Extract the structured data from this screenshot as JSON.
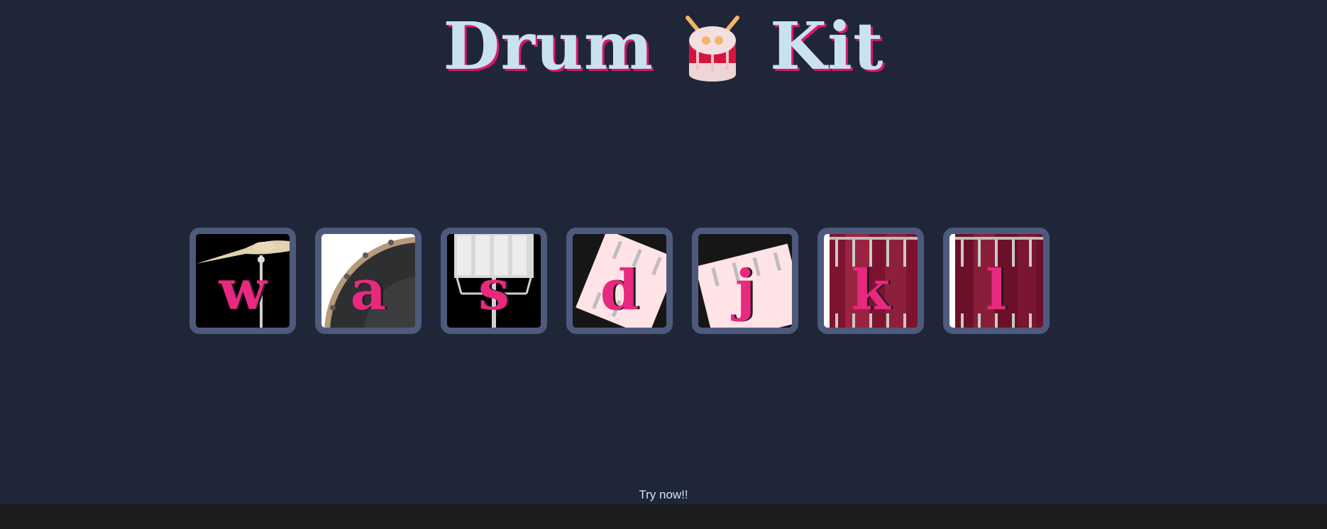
{
  "header": {
    "title_left": "Drum",
    "title_right": "Kit",
    "emoji_icon": "drum-emoji-icon"
  },
  "drums": [
    {
      "key": "w",
      "image": "crash-cymbal"
    },
    {
      "key": "a",
      "image": "kick-bass"
    },
    {
      "key": "s",
      "image": "snare"
    },
    {
      "key": "d",
      "image": "tom-1"
    },
    {
      "key": "j",
      "image": "tom-2"
    },
    {
      "key": "k",
      "image": "tom-3"
    },
    {
      "key": "l",
      "image": "tom-4"
    }
  ],
  "footer": {
    "cta": "Try now!!"
  },
  "colors": {
    "background": "#1f2638",
    "title": "#c9e2ef",
    "accent": "#e8297f",
    "button_border": "#4d5a7c",
    "footer": "#1b1c1e"
  }
}
